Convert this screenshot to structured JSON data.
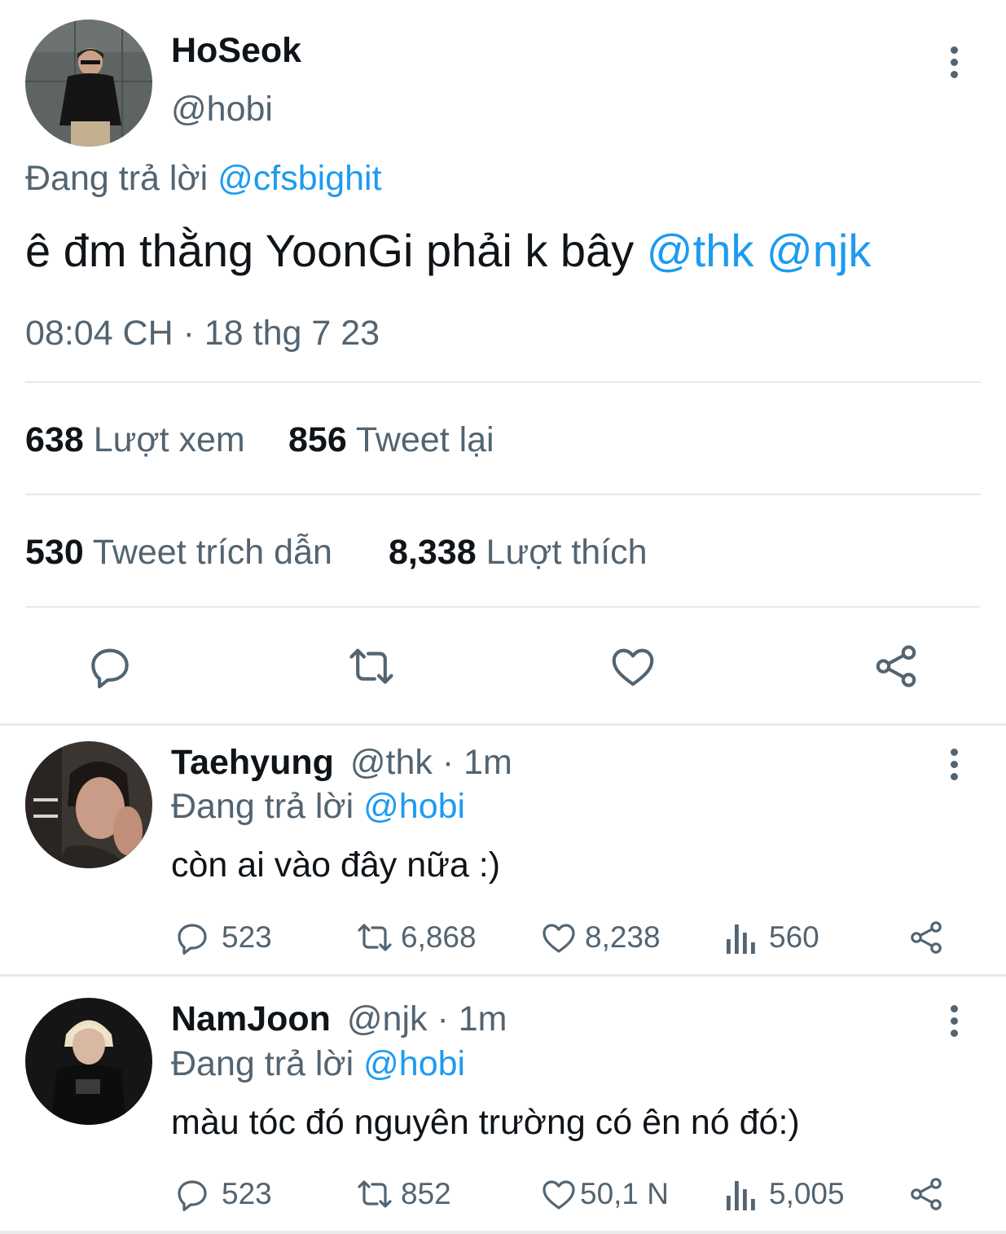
{
  "main_tweet": {
    "name": "HoSeok",
    "handle": "@hobi",
    "reply_prefix": "Đang trả lời",
    "reply_to": "@cfsbighit",
    "text": "ê đm thằng YoonGi phải k bây",
    "mention_1": "@thk",
    "mention_2": "@njk",
    "timestamp": "08:04 CH · 18 thg 7 23",
    "stats": {
      "views_count": "638",
      "views_label": "Lượt xem",
      "retweets_count": "856",
      "retweets_label": "Tweet lại",
      "quotes_count": "530",
      "quotes_label": "Tweet trích dẫn",
      "likes_count": "8,338",
      "likes_label": "Lượt thích"
    }
  },
  "replies": [
    {
      "name": "Taehyung",
      "handle": "@thk",
      "time": "· 1m",
      "reply_prefix": "Đang trả lời",
      "reply_to": "@hobi",
      "text": "còn ai vào đây nữa :)",
      "replies": "523",
      "retweets": "6,868",
      "likes": "8,238",
      "views": "560"
    },
    {
      "name": "NamJoon",
      "handle": "@njk",
      "time": "· 1m",
      "reply_prefix": "Đang trả lời",
      "reply_to": "@hobi",
      "text": "màu tóc đó nguyên trường có ên nó đó:)",
      "replies": "523",
      "retweets": "852",
      "likes": "50,1 N",
      "views": "5,005"
    }
  ],
  "icons": [
    "reply-icon",
    "retweet-icon",
    "like-icon",
    "share-icon",
    "views-icon",
    "more-icon"
  ],
  "colors": {
    "accent": "#1d9bf0",
    "secondary_text": "#536471",
    "primary_text": "#0f1419",
    "divider": "#e7e9ea"
  }
}
